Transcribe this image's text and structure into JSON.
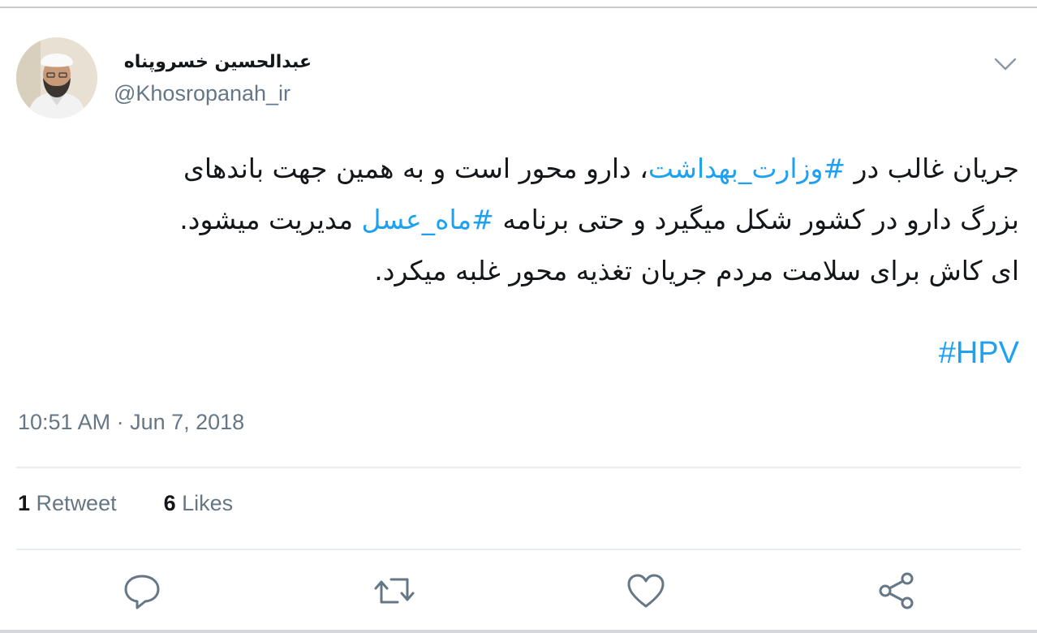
{
  "author": {
    "display_name": "عبدالحسین خسروپناه",
    "handle": "@Khosropanah_ir"
  },
  "tweet": {
    "line1": {
      "before": "جریان غالب در ",
      "hashtag": "#وزارت_بهداشت",
      "after": "، دارو محور است و به همین جهت باندهای"
    },
    "line2": {
      "before": "بزرگ دارو در کشور شکل میگیرد و حتی برنامه ",
      "hashtag": "#ماه_عسل",
      "after": " مدیریت میشود."
    },
    "line3": "ای کاش برای سلامت مردم جریان تغذیه محور غلبه میکرد.",
    "trailing_hashtag": "#HPV"
  },
  "timestamp": "10:51 AM · Jun 7, 2018",
  "stats": {
    "retweets_count": "1",
    "retweets_label": "Retweet",
    "likes_count": "6",
    "likes_label": "Likes"
  },
  "actions": {
    "reply": "reply-icon",
    "retweet": "retweet-icon",
    "like": "heart-icon",
    "share": "share-icon"
  },
  "colors": {
    "hashtag": "#1da1f2",
    "secondary_text": "#657786",
    "primary_text": "#14171a",
    "icon": "#657786"
  }
}
